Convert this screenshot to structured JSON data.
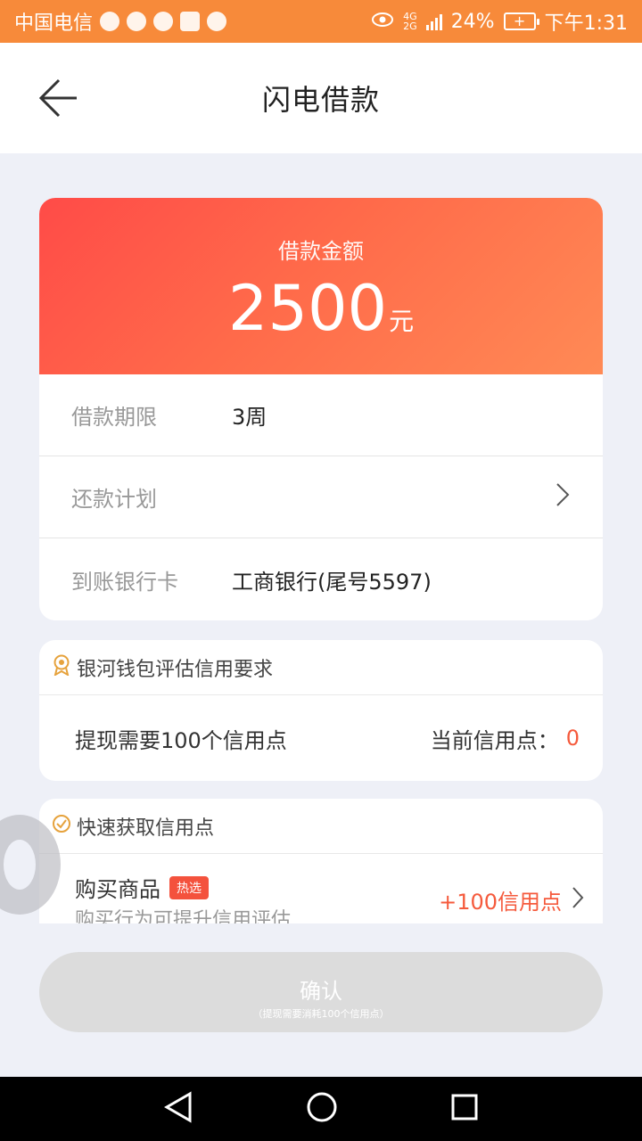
{
  "status_bar": {
    "carrier": "中国电信",
    "network": [
      "4G",
      "2G"
    ],
    "battery_percent": "24%",
    "time": "下午1:31"
  },
  "header": {
    "title": "闪电借款"
  },
  "loan": {
    "amount_label": "借款金额",
    "amount_value": "2500",
    "amount_unit": "元",
    "rows": [
      {
        "label": "借款期限",
        "value": "3周"
      },
      {
        "label": "还款计划",
        "value": ""
      },
      {
        "label": "到账银行卡",
        "value": "工商银行(尾号5597)"
      }
    ]
  },
  "credit_requirement": {
    "title": "银河钱包评估信用要求",
    "requirement": "提现需要100个信用点",
    "current_label": "当前信用点：",
    "current_value": "0"
  },
  "quick_credit": {
    "title": "快速获取信用点",
    "item": {
      "title": "购买商品",
      "badge": "热选",
      "subtitle": "购买行为可提升信用评估",
      "points": "+100信用点"
    }
  },
  "confirm": {
    "label": "确认",
    "note": "（提现需要消耗100个信用点）"
  },
  "colors": {
    "status_bar": "#f78a3a",
    "gradient_start": "#ff4b48",
    "gradient_end": "#ff8a55",
    "accent_red": "#f55a3c",
    "page_bg": "#eef0f7"
  }
}
